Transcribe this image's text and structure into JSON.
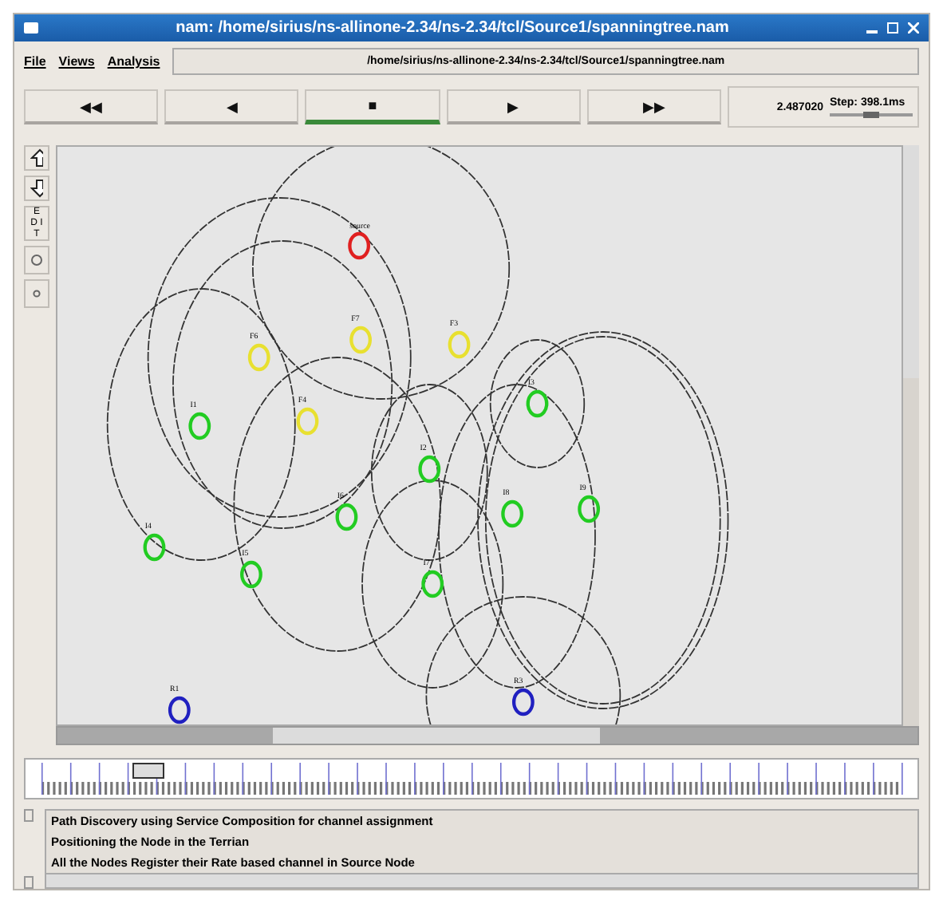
{
  "window": {
    "title": "nam: /home/sirius/ns-allinone-2.34/ns-2.34/tcl/Source1/spanningtree.nam"
  },
  "menu": [
    "File",
    "Views",
    "Analysis"
  ],
  "file_path": "/home/sirius/ns-allinone-2.34/ns-2.34/tcl/Source1/spanningtree.nam",
  "playback_buttons": [
    {
      "symbol": "◀◀",
      "selected": false
    },
    {
      "symbol": "◀",
      "selected": false
    },
    {
      "symbol": "■",
      "selected": true
    },
    {
      "symbol": "▶",
      "selected": false
    },
    {
      "symbol": "▶▶",
      "selected": false
    }
  ],
  "time": "2.487020",
  "step": {
    "label": "Step: 398.1ms",
    "level": 0.5
  },
  "tools": [
    {
      "kind": "zoom-in"
    },
    {
      "kind": "zoom-out"
    },
    {
      "kind": "text",
      "label": "ED IT"
    },
    {
      "kind": "circle"
    },
    {
      "kind": "dot"
    }
  ],
  "nodes": [
    {
      "label": "source",
      "color": "#e02020"
    },
    {
      "label": "F6",
      "color": "#e8e030"
    },
    {
      "label": "F7",
      "color": "#e8e030"
    },
    {
      "label": "F3",
      "color": "#e8e030"
    },
    {
      "label": "F4",
      "color": "#e8e030"
    },
    {
      "label": "I1",
      "color": "#22cc22"
    },
    {
      "label": "I2",
      "color": "#22cc22"
    },
    {
      "label": "I3",
      "color": "#22cc22"
    },
    {
      "label": "I4",
      "color": "#22cc22"
    },
    {
      "label": "I5",
      "color": "#22cc22"
    },
    {
      "label": "I6",
      "color": "#22cc22"
    },
    {
      "label": "I7",
      "color": "#22cc22"
    },
    {
      "label": "I8",
      "color": "#22cc22"
    },
    {
      "label": "I9",
      "color": "#22cc22"
    },
    {
      "label": "R1",
      "color": "#2020c0"
    },
    {
      "label": "R3",
      "color": "#2020c0"
    }
  ],
  "timeline": {
    "level": 0.12
  },
  "annotations": [
    "Path Discovery using Service Composition for channel assignment",
    "Positioning the Node in the Terrian",
    "All the Nodes Register their Rate based channel in Source Node"
  ]
}
